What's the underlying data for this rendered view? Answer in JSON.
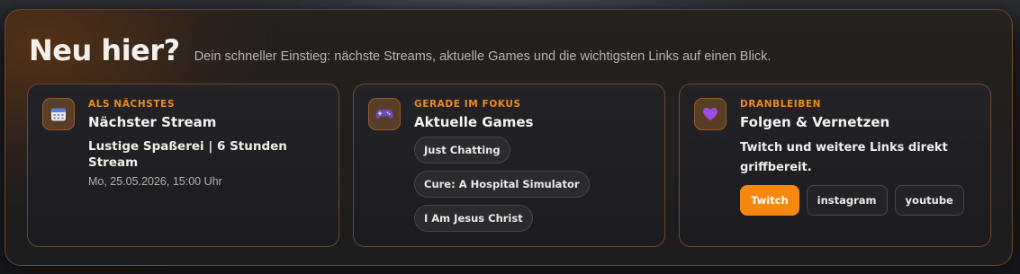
{
  "header": {
    "title": "Neu hier?",
    "subtitle": "Dein schneller Einstieg: nächste Streams, aktuelle Games und die wichtigsten Links auf einen Blick."
  },
  "cards": {
    "next_stream": {
      "icon": "calendar-icon",
      "eyebrow": "ALS NÄCHSTES",
      "title": "Nächster Stream",
      "stream_name": "Lustige Spaßerei | 6 Stunden Stream",
      "datetime": "Mo, 25.05.2026, 15:00 Uhr"
    },
    "games": {
      "icon": "gamepad-icon",
      "eyebrow": "GERADE IM FOKUS",
      "title": "Aktuelle Games",
      "items": [
        "Just Chatting",
        "Cure: A Hospital Simulator",
        "I Am Jesus Christ"
      ]
    },
    "follow": {
      "icon": "purple-heart-icon",
      "eyebrow": "DRANBLEIBEN",
      "title": "Folgen & Vernetzen",
      "text": "Twitch und weitere Links direkt griffbereit.",
      "links": [
        "Twitch",
        "instagram",
        "youtube"
      ]
    }
  },
  "colors": {
    "accent": "#f6870f",
    "eyebrow": "#f08a1c",
    "border": "#a8682c"
  }
}
